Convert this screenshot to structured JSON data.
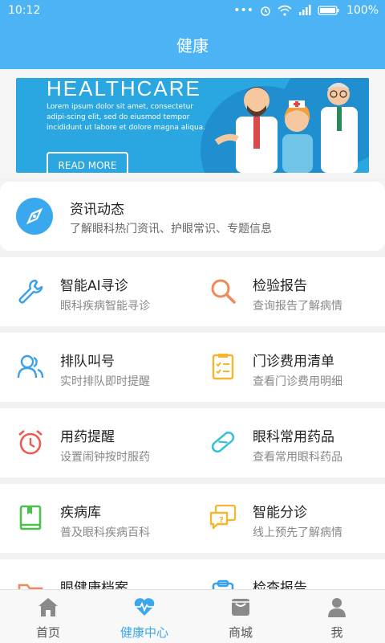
{
  "status": {
    "time": "10:12",
    "battery": "100%"
  },
  "title": "健康",
  "banner": {
    "heading": "HEALTHCARE",
    "desc": "Lorem ipsum dolor sit amet, consectetur adipi-scing elit, sed do eiusmod tempor incididunt ut labore et dolore magna aliqua.",
    "cta": "READ MORE"
  },
  "news": {
    "title": "资讯动态",
    "subtitle": "了解眼科热门资讯、护眼常识、专题信息"
  },
  "grid": [
    {
      "left": {
        "title": "智能AI寻诊",
        "subtitle": "眼科疾病智能寻诊",
        "icon": "wrench-icon"
      },
      "right": {
        "title": "检验报告",
        "subtitle": "查询报告了解病情",
        "icon": "search-icon"
      }
    },
    {
      "left": {
        "title": "排队叫号",
        "subtitle": "实时排队即时提醒",
        "icon": "users-icon"
      },
      "right": {
        "title": "门诊费用清单",
        "subtitle": "查看门诊费用明细",
        "icon": "checklist-icon"
      }
    },
    {
      "left": {
        "title": "用药提醒",
        "subtitle": "设置闹钟按时服药",
        "icon": "alarm-clock-icon"
      },
      "right": {
        "title": "眼科常用药品",
        "subtitle": "查看常用眼科药品",
        "icon": "pill-icon"
      }
    },
    {
      "left": {
        "title": "疾病库",
        "subtitle": "普及眼科疾病百科",
        "icon": "book-icon"
      },
      "right": {
        "title": "智能分诊",
        "subtitle": "线上预先了解病情",
        "icon": "chat-question-icon"
      }
    },
    {
      "left": {
        "title": "眼健康档案",
        "subtitle": "",
        "icon": "folder-icon"
      },
      "right": {
        "title": "检查报告",
        "subtitle": "",
        "icon": "clipboard-icon"
      }
    }
  ],
  "tabs": [
    {
      "label": "首页",
      "icon": "home-icon"
    },
    {
      "label": "健康中心",
      "icon": "heartbeat-icon"
    },
    {
      "label": "商城",
      "icon": "shop-icon"
    },
    {
      "label": "我",
      "icon": "person-icon"
    }
  ],
  "colors": {
    "primary": "#4cb4f5",
    "active_tab": "#3ba8ee"
  }
}
